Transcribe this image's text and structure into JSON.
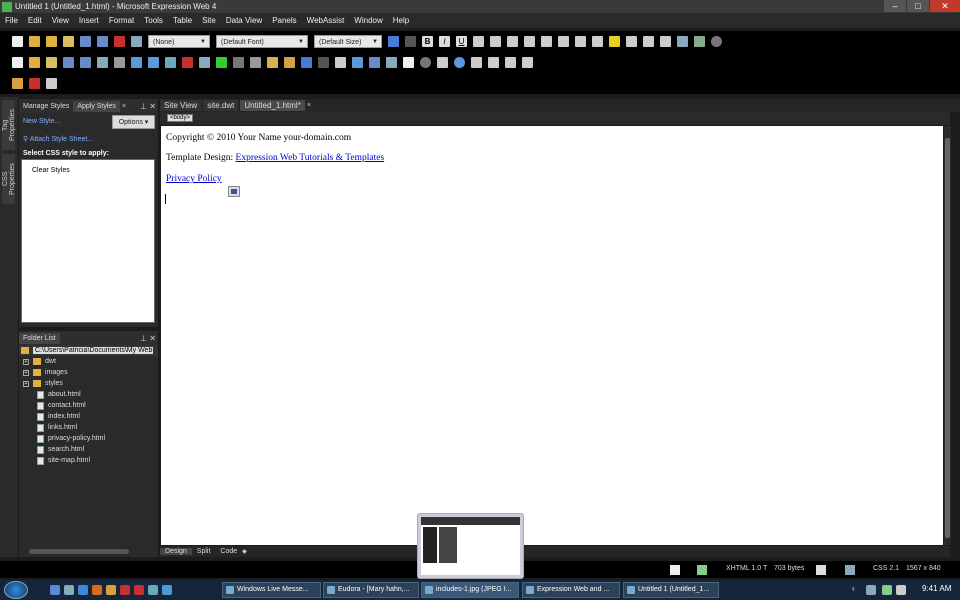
{
  "window": {
    "title": "Untitled 1 (Untitled_1.html) - Microsoft Expression Web 4",
    "minimize": "–",
    "maximize": "□",
    "close": "✕"
  },
  "menu": [
    "File",
    "Edit",
    "View",
    "Insert",
    "Format",
    "Tools",
    "Table",
    "Site",
    "Data View",
    "Panels",
    "WebAssist",
    "Window",
    "Help"
  ],
  "toolbar": {
    "style_value": "(None)",
    "font_value": "(Default Font)",
    "size_value": "(Default Size)",
    "bold": "B",
    "italic": "I",
    "underline": "U"
  },
  "left_strip": {
    "tag_properties": "Tag Properties",
    "css_properties": "CSS Properties"
  },
  "styles_panel": {
    "tabs": [
      "Manage Styles",
      "Apply Styles"
    ],
    "new_style": "New Style...",
    "options": "Options",
    "attach_style_sheet": "Attach Style Sheet...",
    "select_label": "Select CSS style to apply:",
    "clear_styles": "Clear Styles"
  },
  "folder_panel": {
    "title": "Folder List",
    "path": "C:\\Users\\Patricia\\Documents\\My Web Sites",
    "folders": [
      "dwt",
      "images",
      "styles"
    ],
    "files": [
      "about.html",
      "contact.html",
      "index.html",
      "links.html",
      "privacy-policy.html",
      "search.html",
      "site-map.html"
    ]
  },
  "editor": {
    "tabs": [
      "Site View",
      "site.dwt",
      "Untitled_1.html*"
    ],
    "tag_selector": "<body>",
    "content": {
      "copyright": "Copyright © 2010 Your Name your-domain.com",
      "template_prefix": "Template Design: ",
      "template_link": "Expression Web Tutorials & Templates",
      "privacy_link": "Privacy Policy"
    },
    "views": [
      "Design",
      "Split",
      "Code"
    ]
  },
  "status": {
    "doctype": "XHTML 1.0 T",
    "size": "703 bytes",
    "css": "CSS 2.1",
    "dimensions": "1567 x 840"
  },
  "taskbar": {
    "tasks": [
      "Windows Live Messe...",
      "Eudora - [Mary hahn,...",
      "includes-1.jpg (JPEG I...",
      "Expression Web and ...",
      "Untitled 1 (Untitled_1..."
    ],
    "clock": "9:41 AM"
  }
}
